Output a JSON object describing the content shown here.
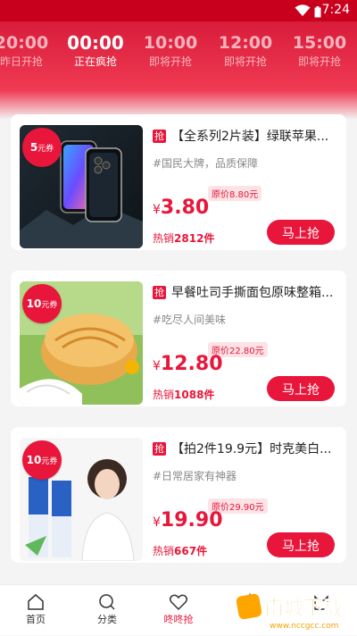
{
  "status": {
    "time": "7:24"
  },
  "time_tabs": [
    {
      "time": "20:00",
      "status": "昨日开抢"
    },
    {
      "time": "00:00",
      "status": "正在疯抢"
    },
    {
      "time": "10:00",
      "status": "即将开抢"
    },
    {
      "time": "12:00",
      "status": "即将开抢"
    },
    {
      "time": "15:00",
      "status": "即将开抢"
    }
  ],
  "products": [
    {
      "coupon": "5",
      "coupon_unit": "元券",
      "tag": "抢",
      "title": "【全系列2片装】绿联苹果...",
      "subtitle": "#国民大牌，品质保障",
      "currency": "¥",
      "price": "3.80",
      "original": "原价8.80元",
      "sales_label": "热销",
      "sales_value": "2812件",
      "buy": "马上抢"
    },
    {
      "coupon": "10",
      "coupon_unit": "元券",
      "tag": "抢",
      "title": "早餐吐司手撕面包原味整箱...",
      "subtitle": "#吃尽人间美味",
      "currency": "¥",
      "price": "12.80",
      "original": "原价22.80元",
      "sales_label": "热销",
      "sales_value": "1088件",
      "buy": "马上抢"
    },
    {
      "coupon": "10",
      "coupon_unit": "元券",
      "tag": "抢",
      "title": "【拍2件19.9元】时克美白...",
      "subtitle": "#日常居家有神器",
      "currency": "¥",
      "price": "19.90",
      "original": "原价29.90元",
      "sales_label": "热销",
      "sales_value": "667件",
      "buy": "马上抢"
    }
  ],
  "bottom_nav": [
    {
      "label": "首页",
      "icon": "home-icon"
    },
    {
      "label": "分类",
      "icon": "search-icon"
    },
    {
      "label": "咚咚抢",
      "icon": "heart-icon"
    }
  ],
  "watermark": {
    "text": "南城下载",
    "url": "www.nccgcc.com"
  },
  "colors": {
    "accent": "#e8163a",
    "header": "#d81c3a"
  }
}
